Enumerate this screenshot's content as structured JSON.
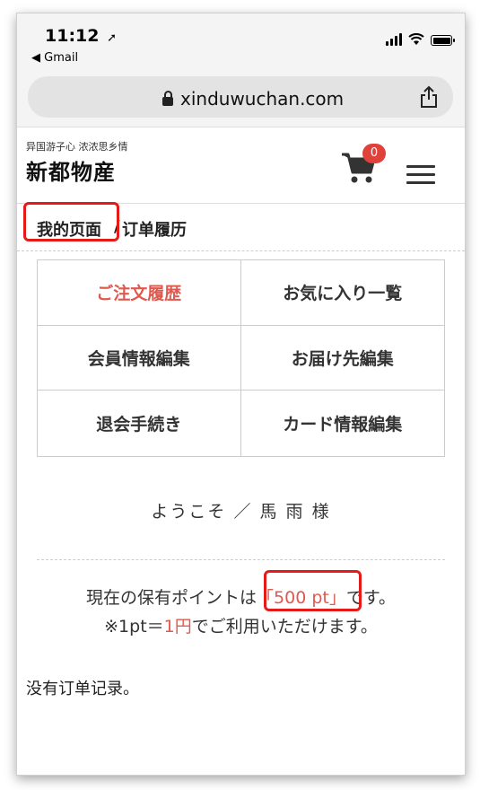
{
  "status_bar": {
    "time": "11:12",
    "location_arrow": "location-arrow-icon",
    "back_app": "◀ Gmail"
  },
  "browser": {
    "url": "xinduwuchan.com"
  },
  "header": {
    "tagline": "异国游子心 浓浓思乡情",
    "logo": "新都物産",
    "cart_count": "0",
    "accent_color": "#e0594e",
    "badge_color": "#e0413a"
  },
  "breadcrumb": {
    "link": "我的页面",
    "separator": "/",
    "current": "订单履历"
  },
  "menu_grid": [
    {
      "label": "ご注文履歴",
      "active": true
    },
    {
      "label": "お気に入り一覧"
    },
    {
      "label": "会員情報編集"
    },
    {
      "label": "お届け先編集"
    },
    {
      "label": "退会手続き"
    },
    {
      "label": "カード情報編集"
    }
  ],
  "welcome": "ようこそ ／ 馬 雨 様",
  "points": {
    "line1_prefix": "現在の保有ポイントは",
    "value": "「500 pt」",
    "line1_suffix": "です。",
    "line2_prefix": "※1pt＝",
    "rate": "1円",
    "line2_suffix": "でご利用いただけます。"
  },
  "orders_message": "没有订单记录。"
}
